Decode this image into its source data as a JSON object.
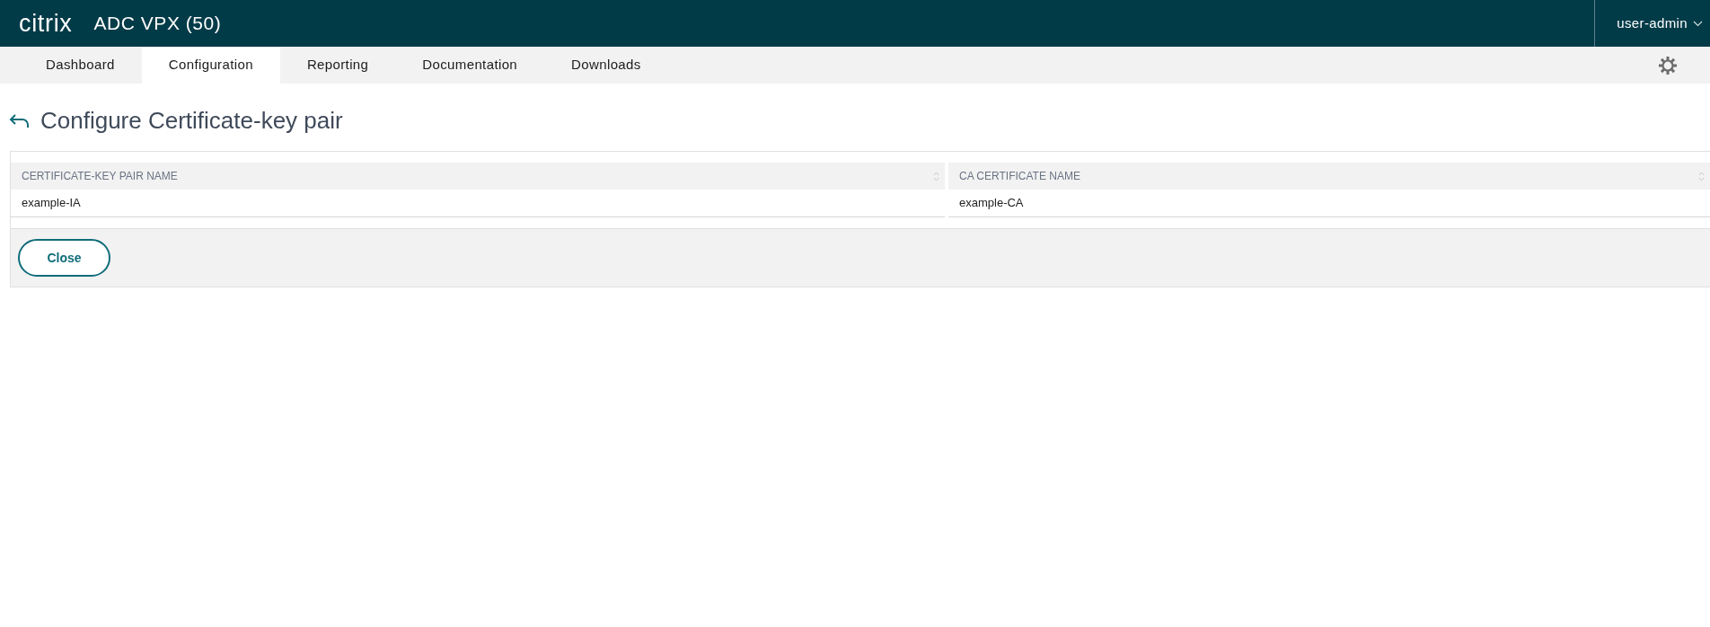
{
  "header": {
    "logo": "citrix",
    "product": "ADC VPX (50)",
    "user": "user-admin"
  },
  "tabs": [
    {
      "label": "Dashboard",
      "selected": false
    },
    {
      "label": "Configuration",
      "selected": true
    },
    {
      "label": "Reporting",
      "selected": false
    },
    {
      "label": "Documentation",
      "selected": false
    },
    {
      "label": "Downloads",
      "selected": false
    }
  ],
  "page_title": "Configure Certificate-key pair",
  "table": {
    "columns": [
      "CERTIFICATE-KEY PAIR NAME",
      "CA CERTIFICATE NAME"
    ],
    "rows": [
      [
        "example-IA",
        "example-CA"
      ]
    ]
  },
  "buttons": [
    "Close"
  ]
}
